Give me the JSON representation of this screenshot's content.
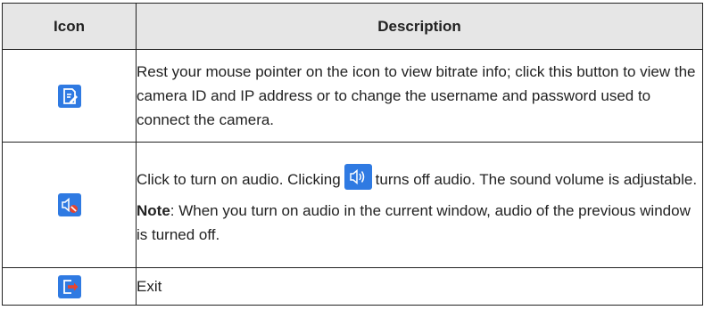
{
  "header": {
    "icon_col": "Icon",
    "desc_col": "Description"
  },
  "rows": [
    {
      "icon": "edit-settings-icon",
      "description": "Rest your mouse pointer on the icon to view bitrate info; click this button to view the camera ID and IP address or to change the username and password used to connect the camera."
    },
    {
      "icon": "audio-muted-icon",
      "description_part1": "Click to turn on audio. Clicking",
      "inline_icon": "audio-on-icon",
      "description_part2": "turns off audio. The sound volume is adjustable.",
      "note_label": "Note",
      "note_text": ": When you turn on audio in the current window, audio of the previous window is turned off."
    },
    {
      "icon": "exit-icon",
      "description": "Exit"
    }
  ],
  "colors": {
    "icon_blue": "#2f7ae2",
    "header_bg": "#e6e6e6",
    "mute_red": "#e8442e",
    "exit_red": "#e8442e"
  }
}
